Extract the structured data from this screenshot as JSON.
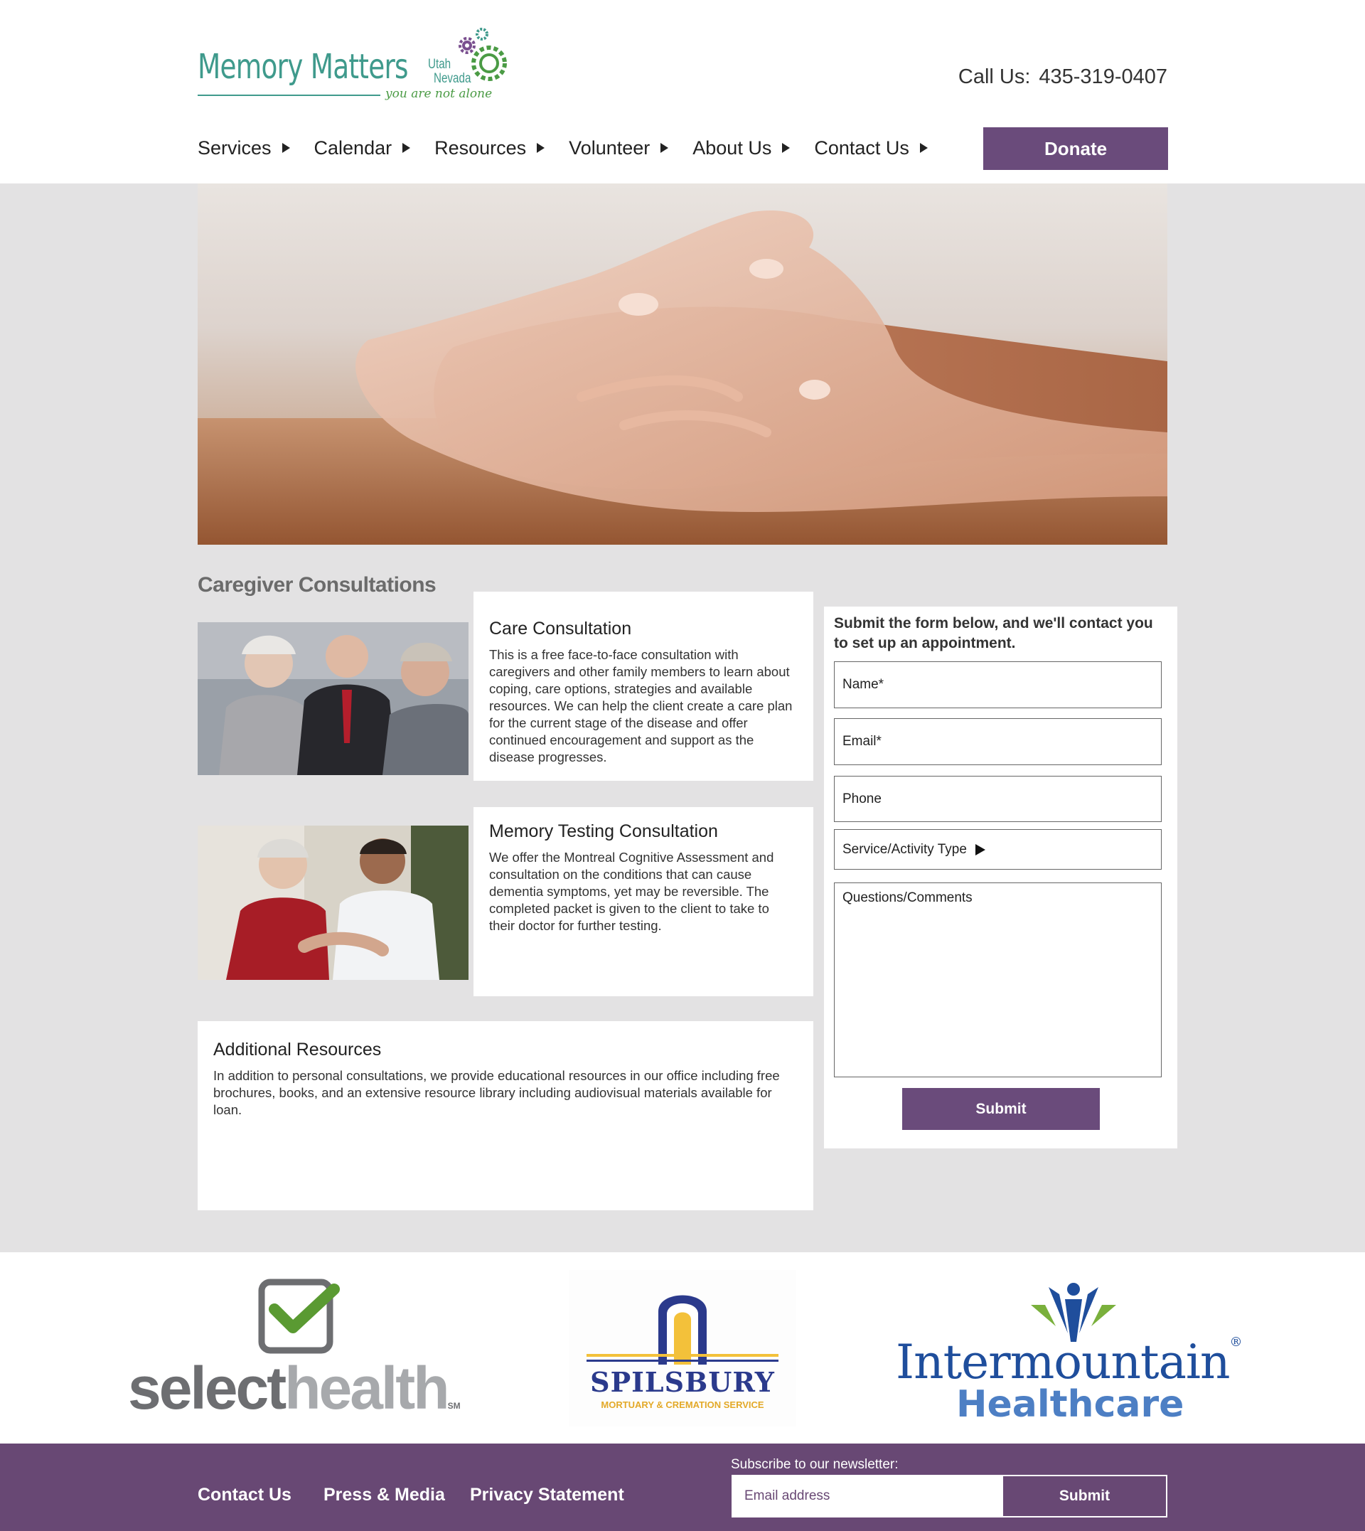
{
  "header": {
    "logo": {
      "wordmark": "Memory Matters",
      "state_line1": "Utah",
      "state_line2": "Nevada",
      "tagline": "you are not alone"
    },
    "call_label": "Call Us:",
    "phone": "435-319-0407",
    "nav": [
      {
        "label": "Services"
      },
      {
        "label": "Calendar"
      },
      {
        "label": "Resources"
      },
      {
        "label": "Volunteer"
      },
      {
        "label": "About Us"
      },
      {
        "label": "Contact Us"
      }
    ],
    "donate_label": "Donate"
  },
  "main": {
    "section_title": "Caregiver Consultations",
    "cards": [
      {
        "title": "Care Consultation",
        "body": "This is a free face-to-face consultation with caregivers and other family members to learn about coping, care options, strategies and available resources. We can help the client create a care plan for the current stage of the disease and offer continued encouragement and support as the disease progresses."
      },
      {
        "title": "Memory Testing Consultation",
        "body": "We offer the Montreal Cognitive Assessment and consultation on the conditions that can cause dementia symptoms, yet may be reversible. The completed packet is given to the client to take to their doctor for further testing."
      },
      {
        "title": "Additional Resources",
        "body": "In addition to personal consultations, we provide educational resources in our office including free brochures, books, and an extensive resource library including audiovisual materials available for loan."
      }
    ]
  },
  "form": {
    "intro": "Submit the form below, and we'll contact you to set up an appointment.",
    "name_label": "Name*",
    "email_label": "Email*",
    "phone_label": "Phone",
    "service_label": "Service/Activity Type",
    "comments_label": "Questions/Comments",
    "submit_label": "Submit"
  },
  "sponsors": {
    "selecthealth": {
      "text_dark": "select",
      "text_light": "health",
      "mark": "SM"
    },
    "spilsbury": {
      "name": "SPILSBURY",
      "sub": "MORTUARY & CREMATION SERVICE"
    },
    "intermountain": {
      "line1": "Intermountain",
      "line2": "Healthcare",
      "mark": "®"
    }
  },
  "footer": {
    "links": [
      "Contact Us",
      "Press & Media",
      "Privacy Statement"
    ],
    "newsletter_label": "Subscribe to our newsletter:",
    "email_placeholder": "Email address",
    "submit_label": "Submit"
  },
  "colors": {
    "brand_purple": "#6a4b7b",
    "footer_purple": "#684874",
    "logo_teal": "#3f9a8c",
    "logo_green": "#4b9b45",
    "page_gray": "#e3e2e3"
  }
}
